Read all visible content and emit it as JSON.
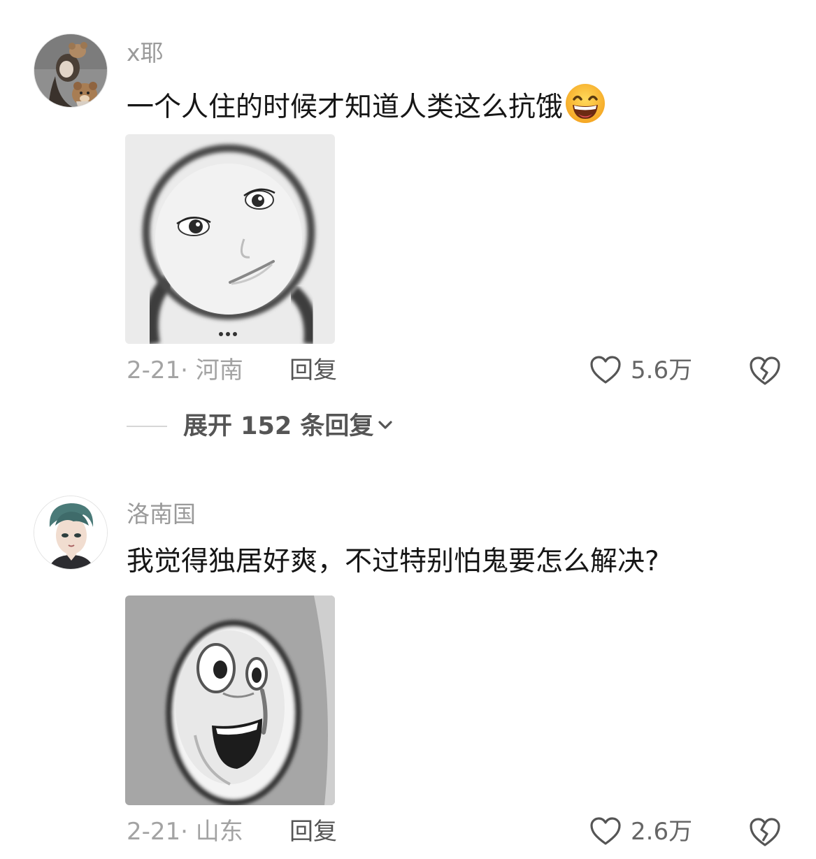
{
  "comments": [
    {
      "username": "x耶",
      "text": "一个人住的时候才知道人类这么抗饿",
      "emoji": "grinning-squint-emoji",
      "date_location": "2-21· 河南",
      "reply_label": "回复",
      "like_count": "5.6万",
      "expand_label": "展开 152 条回复"
    },
    {
      "username": "洛南国",
      "text": "我觉得独居好爽，不过特别怕鬼要怎么解决?",
      "date_location": "2-21· 山东",
      "reply_label": "回复",
      "like_count": "2.6万"
    }
  ],
  "icons": {
    "like": "heart-outline-icon",
    "dislike": "broken-heart-icon",
    "expand": "chevron-down-icon"
  },
  "colors": {
    "username": "#9a9a9a",
    "meta": "#a3a3a3",
    "action": "#555555",
    "emoji": "#f7b92b"
  }
}
